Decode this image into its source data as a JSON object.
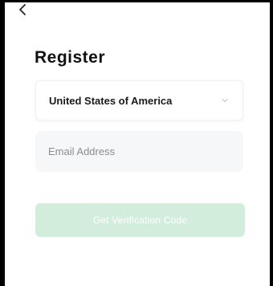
{
  "header": {
    "back_icon": "chevron-left-icon",
    "title": "Register"
  },
  "form": {
    "country": {
      "value": "United States of America",
      "icon": "chevron-down-icon"
    },
    "email": {
      "value": "",
      "placeholder": "Email Address"
    },
    "submit_label": "Get Verification Code"
  },
  "colors": {
    "button_disabled": "#d3eddc",
    "input_bg": "#f6f7f8",
    "title": "#111111"
  }
}
